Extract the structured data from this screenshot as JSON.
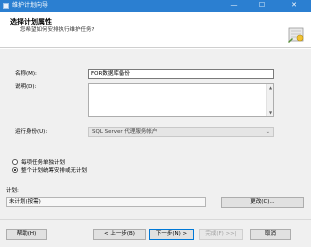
{
  "window": {
    "title": "维护计划向导",
    "controls": {
      "minimize": "—",
      "maximize": "☐",
      "close": "✕"
    }
  },
  "header": {
    "title": "选择计划属性",
    "subtitle": "您希望如何安排执行维护任务?"
  },
  "form": {
    "name_label": "名称(M):",
    "name_value": "FOR数据库备份",
    "description_label": "说明(D):",
    "description_value": "",
    "run_as_label": "运行身份(U):",
    "run_as_value": "SQL Server 代理服务帐户",
    "options": [
      {
        "label": "每项任务单独计划",
        "selected": false
      },
      {
        "label": "整个计划统筹安排或无计划",
        "selected": true
      }
    ],
    "schedule_label": "计划:",
    "schedule_value": "未计划(按需)",
    "change_button": "更改(C)..."
  },
  "footer": {
    "help": "帮助(H)",
    "back": "< 上一步(B)",
    "next": "下一步(N) >",
    "finish": "完成(F) >>|",
    "cancel": "取消"
  },
  "colors": {
    "titlebar": "#2b7fd1",
    "dialog_bg": "#f0f0f0",
    "accent_border": "#0078d7"
  }
}
